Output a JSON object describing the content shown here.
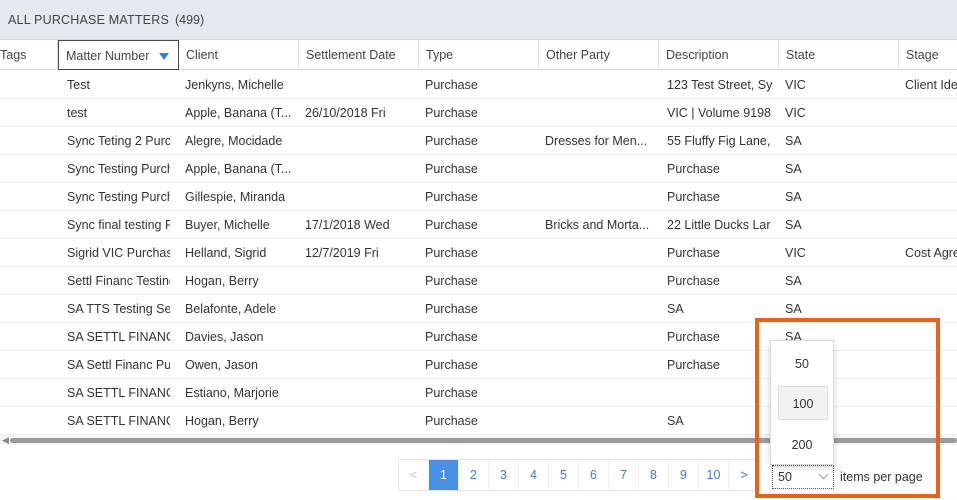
{
  "title": {
    "label": "ALL PURCHASE MATTERS",
    "count": "(499)"
  },
  "columns": [
    {
      "key": "tags",
      "label": "Tags"
    },
    {
      "key": "matter",
      "label": "Matter Number"
    },
    {
      "key": "client",
      "label": "Client"
    },
    {
      "key": "settlement",
      "label": "Settlement Date"
    },
    {
      "key": "type",
      "label": "Type"
    },
    {
      "key": "other",
      "label": "Other Party"
    },
    {
      "key": "description",
      "label": "Description"
    },
    {
      "key": "state",
      "label": "State"
    },
    {
      "key": "stage",
      "label": "Stage"
    }
  ],
  "rows": [
    {
      "tags": "",
      "matter": "Test",
      "client": "Jenkyns, Michelle",
      "settlement": "",
      "type": "Purchase",
      "other": "",
      "description": "123 Test Street, Sy",
      "state": "VIC",
      "stage": "Client Ide"
    },
    {
      "tags": "",
      "matter": "test",
      "client": "Apple, Banana (T...",
      "settlement": "26/10/2018 Fri",
      "type": "Purchase",
      "other": "",
      "description": "VIC | Volume 9198",
      "state": "VIC",
      "stage": ""
    },
    {
      "tags": "",
      "matter": "Sync Teting 2 Purc",
      "client": "Alegre, Mocidade",
      "settlement": "",
      "type": "Purchase",
      "other": "Dresses for Men...",
      "description": "55 Fluffy Fig Lane,",
      "state": "SA",
      "stage": ""
    },
    {
      "tags": "",
      "matter": "Sync Testing Purch",
      "client": "Apple, Banana (T...",
      "settlement": "",
      "type": "Purchase",
      "other": "",
      "description": "Purchase",
      "state": "SA",
      "stage": ""
    },
    {
      "tags": "",
      "matter": "Sync Testing Purch",
      "client": "Gillespie, Miranda",
      "settlement": "",
      "type": "Purchase",
      "other": "",
      "description": "Purchase",
      "state": "SA",
      "stage": ""
    },
    {
      "tags": "",
      "matter": "Sync final testing F",
      "client": "Buyer, Michelle",
      "settlement": "17/1/2018 Wed",
      "type": "Purchase",
      "other": "Bricks and Morta...",
      "description": "22 Little Ducks Lar",
      "state": "SA",
      "stage": ""
    },
    {
      "tags": "",
      "matter": "Sigrid VIC Purchas",
      "client": "Helland, Sigrid",
      "settlement": "12/7/2019 Fri",
      "type": "Purchase",
      "other": "",
      "description": "Purchase",
      "state": "VIC",
      "stage": "Cost Agre"
    },
    {
      "tags": "",
      "matter": "Settl Financ Testing",
      "client": "Hogan, Berry",
      "settlement": "",
      "type": "Purchase",
      "other": "",
      "description": "Purchase",
      "state": "SA",
      "stage": ""
    },
    {
      "tags": "",
      "matter": "SA TTS Testing Set",
      "client": "Belafonte, Adele",
      "settlement": "",
      "type": "Purchase",
      "other": "",
      "description": "SA",
      "state": "SA",
      "stage": ""
    },
    {
      "tags": "",
      "matter": "SA SETTL FINANC",
      "client": "Davies, Jason",
      "settlement": "",
      "type": "Purchase",
      "other": "",
      "description": "Purchase",
      "state": "SA",
      "stage": ""
    },
    {
      "tags": "",
      "matter": "SA Settl Financ Pu",
      "client": "Owen, Jason",
      "settlement": "",
      "type": "Purchase",
      "other": "",
      "description": "Purchase",
      "state": "",
      "stage": ""
    },
    {
      "tags": "",
      "matter": "SA SETTL FINANC",
      "client": "Estiano, Marjorie",
      "settlement": "",
      "type": "Purchase",
      "other": "",
      "description": "",
      "state": "",
      "stage": ""
    },
    {
      "tags": "",
      "matter": "SA SETTL FINANC",
      "client": "Hogan, Berry",
      "settlement": "",
      "type": "Purchase",
      "other": "",
      "description": "SA",
      "state": "",
      "stage": ""
    }
  ],
  "pager": {
    "prev": "<",
    "pages": [
      "1",
      "2",
      "3",
      "4",
      "5",
      "6",
      "7",
      "8",
      "9",
      "10"
    ],
    "next": ">",
    "active": "1"
  },
  "items_per_page": {
    "value": "50",
    "label": "items per page",
    "options": [
      "50",
      "100",
      "200"
    ],
    "highlighted": "100"
  },
  "colors": {
    "accent": "#4a90e2",
    "highlight_border": "#e8621a"
  }
}
